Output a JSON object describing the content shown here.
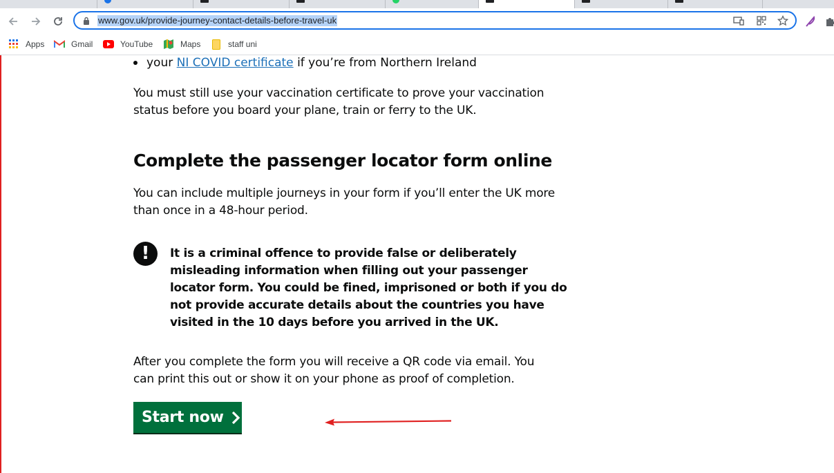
{
  "browser": {
    "url": "www.gov.uk/provide-journey-contact-details-before-travel-uk",
    "bookmarks": [
      {
        "label": "Apps",
        "icon": "apps-grid-icon"
      },
      {
        "label": "Gmail",
        "icon": "gmail-icon"
      },
      {
        "label": "YouTube",
        "icon": "youtube-icon"
      },
      {
        "label": "Maps",
        "icon": "maps-icon"
      },
      {
        "label": "staff uni",
        "icon": "folder-icon"
      }
    ]
  },
  "page": {
    "bullet": {
      "prefix": "your",
      "link": "NI COVID certificate",
      "suffix": "if you’re from Northern Ireland"
    },
    "para1": "You must still use your vaccination certificate to prove your vaccination status before you board your plane, train or ferry to the UK.",
    "heading": "Complete the passenger locator form online",
    "para2": "You can include multiple journeys in your form if you’ll enter the UK more than once in a 48-hour period.",
    "warning": {
      "icon": "!",
      "text": "It is a criminal offence to provide false or deliberately misleading information when filling out your passenger locator form. You could be fined, imprisoned or both if you do not provide accurate details about the countries you have visited in the 10 days before you arrived in the UK."
    },
    "para3": "After you complete the form you will receive a QR code via email. You can print this out or show it on your phone as proof of completion.",
    "start_button": "Start now"
  },
  "colors": {
    "link": "#1d70b8",
    "button": "#00703c",
    "annotation_arrow": "#e02020",
    "omnibox_focus": "#1a73e8"
  }
}
